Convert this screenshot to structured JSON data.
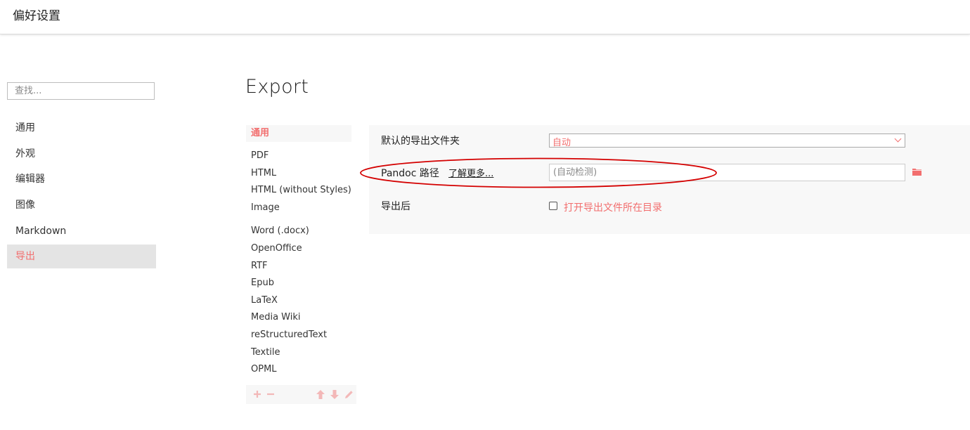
{
  "window": {
    "title": "偏好设置"
  },
  "sidebar": {
    "search_placeholder": "查找...",
    "items": [
      {
        "label": "通用",
        "active": false
      },
      {
        "label": "外观",
        "active": false
      },
      {
        "label": "编辑器",
        "active": false
      },
      {
        "label": "图像",
        "active": false
      },
      {
        "label": "Markdown",
        "active": false
      },
      {
        "label": "导出",
        "active": true
      }
    ]
  },
  "page": {
    "heading": "Export"
  },
  "formats": {
    "selected": "通用",
    "group1": [
      "PDF",
      "HTML",
      "HTML (without Styles)",
      "Image"
    ],
    "group2": [
      "Word (.docx)",
      "OpenOffice",
      "RTF",
      "Epub",
      "LaTeX",
      "Media Wiki",
      "reStructuredText",
      "Textile",
      "OPML"
    ],
    "toolbar_icons": [
      "plus-icon",
      "minus-icon",
      "arrow-up-icon",
      "arrow-down-icon",
      "pencil-icon"
    ]
  },
  "settings": {
    "export_folder": {
      "label": "默认的导出文件夹",
      "value": "自动"
    },
    "pandoc": {
      "label": "Pandoc 路径",
      "learn_more": "了解更多...",
      "placeholder": "(自动检测)"
    },
    "after_export": {
      "label": "导出后",
      "checkbox_label": "打开导出文件所在目录",
      "checked": false
    }
  },
  "colors": {
    "accent": "#f26e6e",
    "annotation": "#d40000",
    "active_bg": "#e4e4e4"
  }
}
